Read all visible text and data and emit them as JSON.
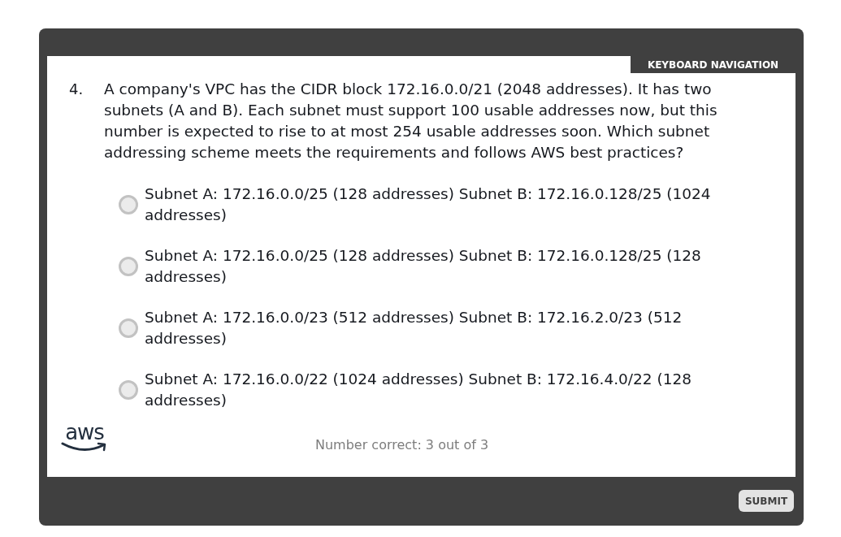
{
  "header": {
    "tab": "KEYBOARD NAVIGATION"
  },
  "question": {
    "number": "4.",
    "text": "A company's VPC has the CIDR block 172.16.0.0/21 (2048 addresses). It has two subnets (A and B). Each subnet must support 100 usable addresses now, but this number is expected to rise to at most 254 usable addresses soon. Which subnet addressing scheme meets the requirements and follows AWS best practices?"
  },
  "options": [
    {
      "text": "Subnet A: 172.16.0.0/25 (128 addresses) Subnet B: 172.16.0.128/25 (1024 addresses)",
      "selected": false
    },
    {
      "text": "Subnet A: 172.16.0.0/25 (128 addresses) Subnet B: 172.16.0.128/25 (128 addresses)",
      "selected": false
    },
    {
      "text": "Subnet A: 172.16.0.0/23 (512 addresses) Subnet B: 172.16.2.0/23 (512 addresses)",
      "selected": false
    },
    {
      "text": "Subnet A: 172.16.0.0/22 (1024 addresses) Subnet B: 172.16.4.0/22 (128 addresses)",
      "selected": false
    }
  ],
  "footer": {
    "logo": "aws",
    "score": "Number correct: 3 out of 3"
  },
  "buttons": [
    {
      "label": "SUBMIT"
    }
  ]
}
